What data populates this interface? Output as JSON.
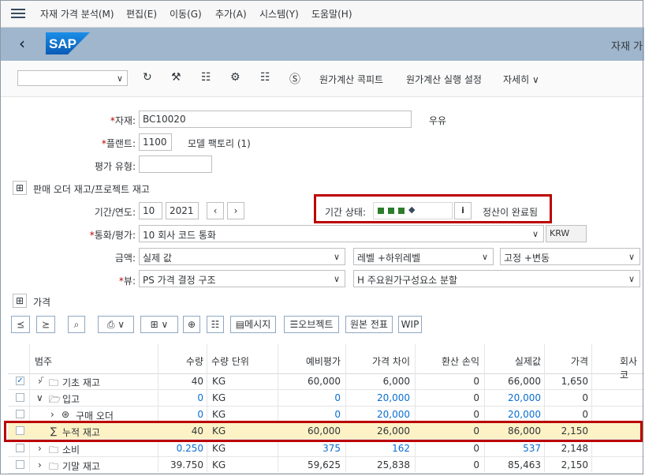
{
  "menubar": {
    "items": [
      "자재 가격 분석(M)",
      "편집(E)",
      "이동(G)",
      "추가(A)",
      "시스템(Y)",
      "도움말(H)"
    ]
  },
  "shell": {
    "logo": "SAP",
    "title": "자재 가"
  },
  "toolbar": {
    "actions": [
      "원가계산 콕피트",
      "원가계산 실행 설정",
      "자세히"
    ]
  },
  "form": {
    "material": {
      "label": "자재:",
      "value": "BC10020",
      "desc": "우유"
    },
    "plant": {
      "label": "플랜트:",
      "value": "1100",
      "desc": "모델 팩토리 (1)"
    },
    "valuation_type": {
      "label": "평가 유형:",
      "value": ""
    },
    "sales_order_stock": {
      "label": "판매 오더 재고/프로젝트 재고"
    },
    "period_year": {
      "label": "기간/연도:",
      "period": "10",
      "year": "2021"
    },
    "period_status": {
      "label": "기간 상태:",
      "status_text": "정산이 완료됨",
      "color": "#2b7d2b"
    },
    "currency": {
      "label": "통화/평가:",
      "value": "10 회사 코드 통화",
      "code": "KRW"
    },
    "amount": {
      "label": "금액:",
      "value": "실제 값",
      "level": "레벨 +하위레벨",
      "fixvar": "고정 +변동"
    },
    "view": {
      "label": "뷰:",
      "value": "PS 가격 결정 구조",
      "breakdown": "H 주요원가구성요소 분할"
    }
  },
  "prices": {
    "label": "가격"
  },
  "toolbar2": {
    "message": "메시지",
    "object": "오브젝트",
    "source_doc": "원본 전표",
    "wip": "WIP"
  },
  "table": {
    "headers": [
      "범주",
      "수량",
      "수량 단위",
      "예비평가",
      "가격 차이",
      "환산 손익",
      "실제값",
      "가격",
      "회사코"
    ],
    "rows": [
      {
        "name": "기초 재고",
        "qty": "40",
        "unit": "KG",
        "prelim": "60,000",
        "pricediff": "6,000",
        "exch": "0",
        "actual": "66,000",
        "price": "1,650"
      },
      {
        "name": "입고",
        "qty": "0",
        "unit": "KG",
        "prelim": "0",
        "pricediff": "20,000",
        "exch": "0",
        "actual": "20,000",
        "price": "0"
      },
      {
        "name": "구매 오더",
        "qty": "0",
        "unit": "KG",
        "prelim": "0",
        "pricediff": "20,000",
        "exch": "0",
        "actual": "20,000",
        "price": "0"
      },
      {
        "name": "누적 재고",
        "qty": "40",
        "unit": "KG",
        "prelim": "60,000",
        "pricediff": "26,000",
        "exch": "0",
        "actual": "86,000",
        "price": "2,150"
      },
      {
        "name": "소비",
        "qty": "0.250",
        "unit": "KG",
        "prelim": "375",
        "pricediff": "162",
        "exch": "0",
        "actual": "537",
        "price": "2,148"
      },
      {
        "name": "기말 재고",
        "qty": "39.750",
        "unit": "KG",
        "prelim": "59,625",
        "pricediff": "25,838",
        "exch": "0",
        "actual": "85,463",
        "price": "2,150"
      }
    ]
  },
  "colors": {
    "highlight": "#bb0000",
    "shell": "#9fb6cd",
    "row_highlight": "#fcf2c5"
  }
}
